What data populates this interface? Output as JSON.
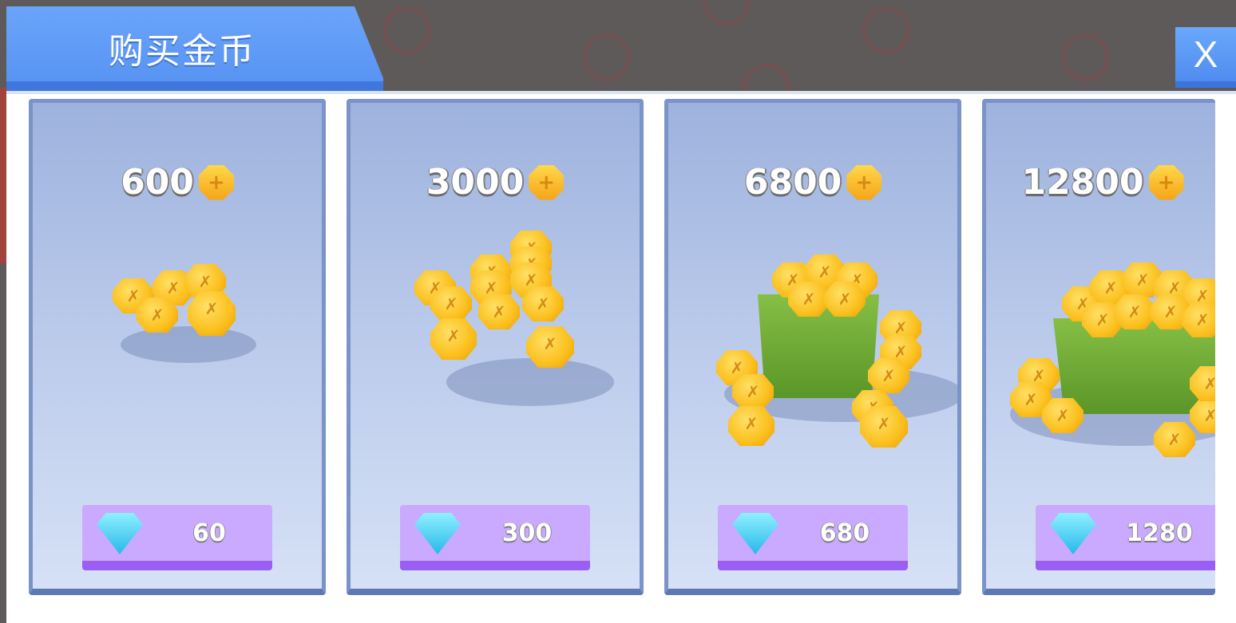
{
  "dialog": {
    "title": "购买金币",
    "close_label": "X"
  },
  "items": [
    {
      "coins": "600",
      "price": "60"
    },
    {
      "coins": "3000",
      "price": "300"
    },
    {
      "coins": "6800",
      "price": "680"
    },
    {
      "coins": "12800",
      "price": "1280"
    }
  ],
  "icons": {
    "currency": "coin-icon",
    "price_currency": "diamond-gem-icon"
  },
  "colors": {
    "header_blue": "#5b96f5",
    "card_blue": "#b9c9ea",
    "button_purple": "#c9aaff",
    "button_purple_dark": "#9a5ef5",
    "coin_gold": "#fbbf1c",
    "box_green": "#6fab35"
  }
}
